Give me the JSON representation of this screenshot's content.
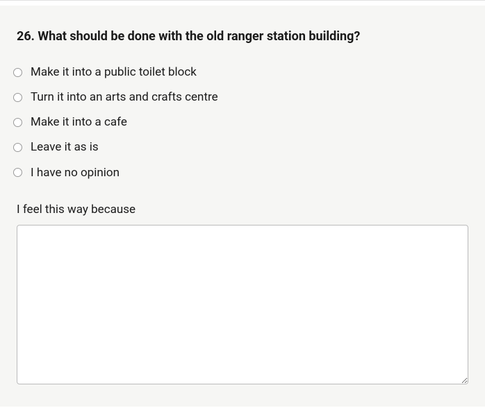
{
  "question": {
    "number": "26.",
    "text": "What should be done with the old ranger station building?",
    "options": [
      "Make it into a public toilet block",
      "Turn it into an arts and crafts centre",
      "Make it into a cafe",
      "Leave it as is",
      "I have no opinion"
    ],
    "followup_label": "I feel this way because",
    "textarea_value": ""
  }
}
